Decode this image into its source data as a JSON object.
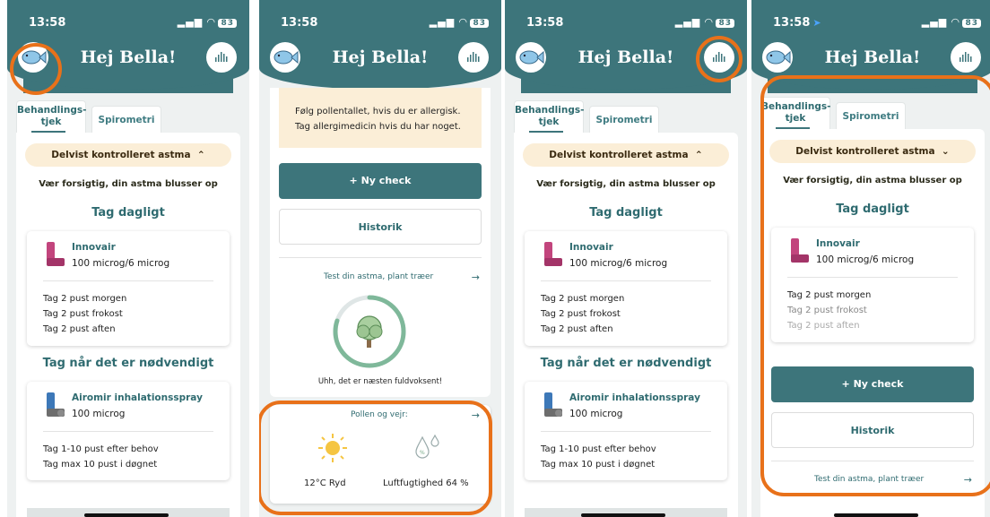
{
  "status": {
    "time": "13:58",
    "battery": "83"
  },
  "header": {
    "greeting": "Hej Bella!"
  },
  "tabs": {
    "behandling_line1": "Behandlings-",
    "behandling_line2": "tjek",
    "spirometri": "Spirometri"
  },
  "treatment": {
    "status_pill": "Delvist kontrolleret astma",
    "warning": "Vær forsigtig, din astma blusser op",
    "section_daily": "Tag dagligt",
    "section_needed": "Tag når det er nødvendigt",
    "med1": {
      "name": "Innovair",
      "dose": "100 microg/6 microg",
      "lines": [
        "Tag 2 pust morgen",
        "Tag 2 pust frokost",
        "Tag 2 pust aften"
      ]
    },
    "med2": {
      "name": "Airomir inhalationsspray",
      "dose": "100 microg",
      "lines": [
        "Tag 1-10 pust efter behov",
        "Tag max 10 pust i døgnet"
      ]
    }
  },
  "home": {
    "pollen_tip_line1": "Følg pollentallet, hvis du er allergisk.",
    "pollen_tip_line2": "Tag allergimedicin hvis du har noget.",
    "new_check": "+ Ny check",
    "history": "Historik",
    "test_link": "Test din astma, plant træer",
    "tree_caption": "Uhh, det er næsten fuldvoksent!",
    "tree_progress": 0.8,
    "pollen_weather": "Pollen og vejr:",
    "temp": "12°C Ryd",
    "humidity": "Luftfugtighed 64 %"
  },
  "colors": {
    "brand": "#3d757b",
    "pill": "#fbeed7",
    "annotation": "#e8711a"
  }
}
